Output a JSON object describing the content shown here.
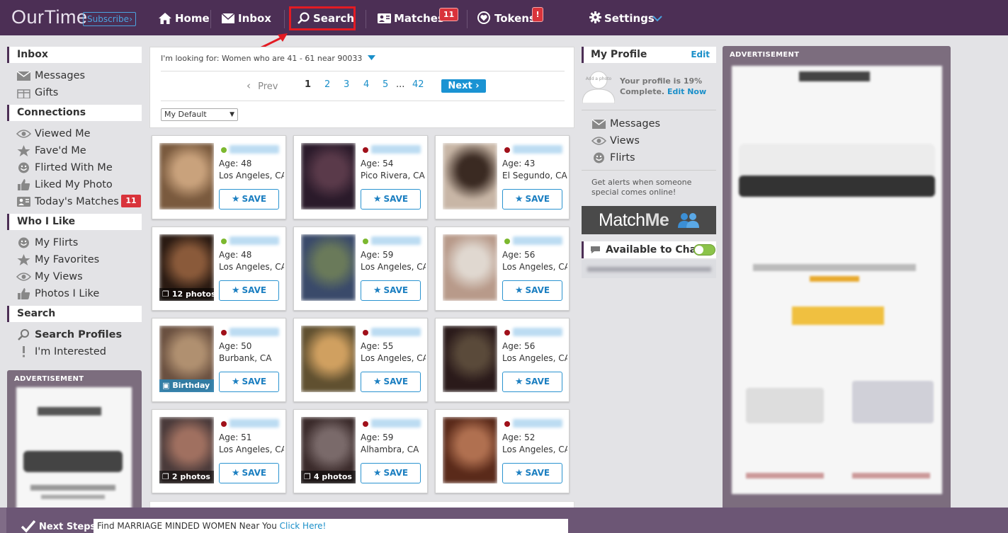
{
  "header": {
    "logo": "OurTime",
    "subscribe": "Subscribe",
    "nav": {
      "home": "Home",
      "inbox": "Inbox",
      "search": "Search",
      "matches": "Matches",
      "matches_count": "11",
      "tokens": "Tokens",
      "tokens_badge": "!",
      "settings": "Settings"
    }
  },
  "sidebar": {
    "inbox": {
      "title": "Inbox",
      "items": [
        {
          "label": "Messages",
          "icon": "envelope-icon"
        },
        {
          "label": "Gifts",
          "icon": "gift-icon"
        }
      ]
    },
    "connections": {
      "title": "Connections",
      "items": [
        {
          "label": "Viewed Me",
          "icon": "eye-icon"
        },
        {
          "label": "Fave'd Me",
          "icon": "star-icon"
        },
        {
          "label": "Flirted With Me",
          "icon": "smiley-icon"
        },
        {
          "label": "Liked My Photo",
          "icon": "thumbs-up-icon"
        },
        {
          "label": "Today's Matches",
          "icon": "matches-icon",
          "count": "11"
        }
      ]
    },
    "who_i_like": {
      "title": "Who I Like",
      "items": [
        {
          "label": "My Flirts",
          "icon": "smiley-icon"
        },
        {
          "label": "My Favorites",
          "icon": "star-icon"
        },
        {
          "label": "My Views",
          "icon": "eye-icon"
        },
        {
          "label": "Photos I Like",
          "icon": "thumbs-up-icon"
        }
      ]
    },
    "search": {
      "title": "Search",
      "items": [
        {
          "label": "Search Profiles",
          "icon": "search-icon"
        },
        {
          "label": "I'm Interested",
          "icon": "exclamation-icon"
        }
      ]
    },
    "ad_label": "ADVERTISEMENT"
  },
  "search_panel": {
    "looking_for": "I'm looking for: Women who are 41 - 61 near 90033",
    "prev": "Prev",
    "pages": [
      "1",
      "2",
      "3",
      "4",
      "5",
      "...",
      "42"
    ],
    "current_page": "1",
    "next": "Next",
    "sort": "My Default"
  },
  "cards": [
    {
      "age": "Age: 48",
      "location": "Los Angeles, CA",
      "online": "#7cb82f",
      "tag": "",
      "save": "SAVE"
    },
    {
      "age": "Age: 54",
      "location": "Pico Rivera, CA",
      "online": "#a0101a",
      "tag": "",
      "save": "SAVE"
    },
    {
      "age": "Age: 43",
      "location": "El Segundo, CA",
      "online": "#a0101a",
      "tag": "",
      "save": "SAVE"
    },
    {
      "age": "Age: 48",
      "location": "Los Angeles, CA",
      "online": "#7cb82f",
      "tag": "12 photos",
      "save": "SAVE"
    },
    {
      "age": "Age: 59",
      "location": "Los Angeles, CA",
      "online": "#7cb82f",
      "tag": "",
      "save": "SAVE"
    },
    {
      "age": "Age: 56",
      "location": "Los Angeles, CA",
      "online": "#7cb82f",
      "tag": "",
      "save": "SAVE"
    },
    {
      "age": "Age: 50",
      "location": "Burbank, CA",
      "online": "#a0101a",
      "tag": "Birthday",
      "save": "SAVE"
    },
    {
      "age": "Age: 55",
      "location": "Los Angeles, CA",
      "online": "#a0101a",
      "tag": "",
      "save": "SAVE"
    },
    {
      "age": "Age: 56",
      "location": "Los Angeles, CA",
      "online": "#a0101a",
      "tag": "",
      "save": "SAVE"
    },
    {
      "age": "Age: 51",
      "location": "Los Angeles, CA",
      "online": "#a0101a",
      "tag": "2 photos",
      "save": "SAVE"
    },
    {
      "age": "Age: 59",
      "location": "Alhambra, CA",
      "online": "#a0101a",
      "tag": "4 photos",
      "save": "SAVE"
    },
    {
      "age": "Age: 52",
      "location": "Los Angeles, CA",
      "online": "#a0101a",
      "tag": "",
      "save": "SAVE"
    }
  ],
  "profile": {
    "title": "My Profile",
    "edit": "Edit",
    "avatar_text": "Add a photo",
    "complete_text": "Your profile is 19% Complete.",
    "edit_now": "Edit Now",
    "links": [
      {
        "label": "Messages",
        "icon": "envelope-icon"
      },
      {
        "label": "Views",
        "icon": "eye-icon"
      },
      {
        "label": "Flirts",
        "icon": "smiley-icon"
      }
    ],
    "alerts": "Get alerts when someone special comes online!",
    "matchme_a": "Match",
    "matchme_b": "Me",
    "chat_title": "Available to Chat"
  },
  "right_ad_label": "ADVERTISEMENT",
  "bottom": {
    "next_steps": "Next Steps:",
    "text": "Find MARRIAGE MINDED WOMEN Near You",
    "link": "Click Here!"
  },
  "colors": {
    "header_bg": "#4c2f55",
    "accent_blue": "#1a93d3",
    "badge_red": "#d9333b",
    "highlight_red": "#e31b23"
  }
}
